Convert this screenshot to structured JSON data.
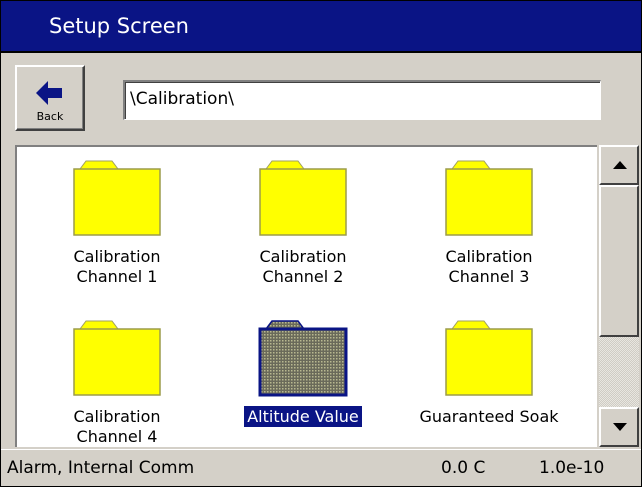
{
  "window": {
    "title": "Setup Screen"
  },
  "toolbar": {
    "back_label": "Back",
    "path": "\\Calibration\\"
  },
  "folders": [
    {
      "label_line1": "Calibration",
      "label_line2": "Channel 1",
      "icon": "folder-icon",
      "selected": false
    },
    {
      "label_line1": "Calibration",
      "label_line2": "Channel 2",
      "icon": "folder-icon",
      "selected": false
    },
    {
      "label_line1": "Calibration",
      "label_line2": "Channel 3",
      "icon": "folder-icon",
      "selected": false
    },
    {
      "label_line1": "Calibration",
      "label_line2": "Channel 4",
      "icon": "folder-icon",
      "selected": false
    },
    {
      "label_line1": "Altitude Value",
      "label_line2": "",
      "icon": "folder-icon",
      "selected": true
    },
    {
      "label_line1": "Guaranteed Soak",
      "label_line2": "",
      "icon": "folder-icon",
      "selected": false
    }
  ],
  "status": {
    "message": "Alarm, Internal Comm",
    "temperature": "0.0 C",
    "value": "1.0e-10"
  },
  "colors": {
    "title_bar": "#0a1485",
    "folder_fill": "#ffff00",
    "panel": "#d4d0c8"
  }
}
